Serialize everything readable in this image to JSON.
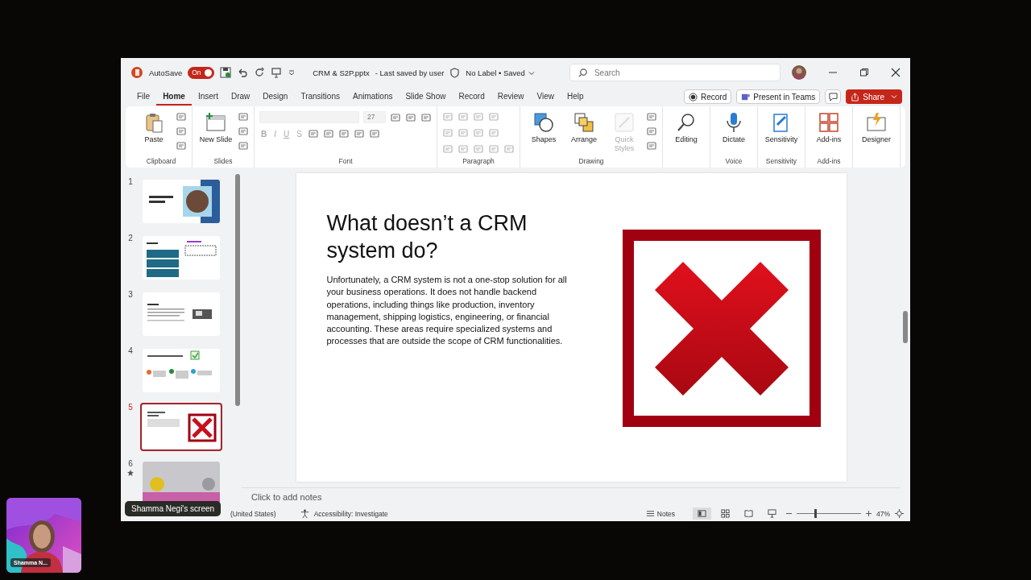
{
  "meeting": {
    "screen_label": "Shamma Negi's screen",
    "participant_name": "Shamma N..."
  },
  "window": {
    "autosave_label": "AutoSave",
    "autosave_on": true,
    "autosave_state": "On",
    "file_name": "CRM & S2P.pptx",
    "save_status": "- Last saved by user",
    "sensitivity_label": "No Label • Saved",
    "search_placeholder": "Search"
  },
  "ribbon_tabs": [
    {
      "label": "File",
      "selected": false
    },
    {
      "label": "Home",
      "selected": true
    },
    {
      "label": "Insert",
      "selected": false
    },
    {
      "label": "Draw",
      "selected": false
    },
    {
      "label": "Design",
      "selected": false
    },
    {
      "label": "Transitions",
      "selected": false
    },
    {
      "label": "Animations",
      "selected": false
    },
    {
      "label": "Slide Show",
      "selected": false
    },
    {
      "label": "Record",
      "selected": false
    },
    {
      "label": "Review",
      "selected": false
    },
    {
      "label": "View",
      "selected": false
    },
    {
      "label": "Help",
      "selected": false
    }
  ],
  "ribbon_actions": {
    "record": "Record",
    "present": "Present in Teams",
    "share": "Share"
  },
  "ribbon_groups": [
    {
      "kind": "clipboard",
      "name": "Clipboard",
      "commands": [
        {
          "label": "Paste",
          "kind": "paste",
          "disabled": false
        }
      ]
    },
    {
      "kind": "slides",
      "name": "Slides",
      "commands": [
        {
          "label": "New Slide",
          "kind": "new-slide",
          "disabled": false
        }
      ]
    },
    {
      "kind": "font",
      "name": "Font",
      "font_size": "27",
      "format_buttons": [
        "B",
        "I",
        "U",
        "S"
      ],
      "disabled": true
    },
    {
      "kind": "paragraph",
      "name": "Paragraph",
      "disabled": true
    },
    {
      "kind": "drawing",
      "name": "Drawing",
      "commands": [
        {
          "label": "Shapes",
          "kind": "shapes",
          "disabled": false
        },
        {
          "label": "Arrange",
          "kind": "arrange",
          "disabled": false
        },
        {
          "label": "Quick Styles",
          "kind": "quick-styles",
          "disabled": true
        }
      ]
    },
    {
      "kind": "commands",
      "commands": [
        {
          "label": "Editing",
          "kind": "editing",
          "disabled": false
        }
      ]
    },
    {
      "kind": "commands",
      "name": "Voice",
      "commands": [
        {
          "label": "Dictate",
          "kind": "dictate",
          "disabled": false
        }
      ]
    },
    {
      "kind": "commands",
      "name": "Sensitivity",
      "commands": [
        {
          "label": "Sensitivity",
          "kind": "sensitivity",
          "disabled": false
        }
      ]
    },
    {
      "kind": "commands",
      "name": "Add-ins",
      "commands": [
        {
          "label": "Add-ins",
          "kind": "add-ins",
          "disabled": false
        }
      ]
    },
    {
      "kind": "commands",
      "commands": [
        {
          "label": "Designer",
          "kind": "designer",
          "disabled": false
        }
      ]
    }
  ],
  "slides": [
    {
      "number": "1",
      "selected": false,
      "starred": false
    },
    {
      "number": "2",
      "selected": false,
      "starred": false
    },
    {
      "number": "3",
      "selected": false,
      "starred": false
    },
    {
      "number": "4",
      "selected": false,
      "starred": false
    },
    {
      "number": "5",
      "selected": true,
      "starred": false
    },
    {
      "number": "6",
      "selected": false,
      "starred": true
    }
  ],
  "slide": {
    "title": "What doesn’t a CRM system do?",
    "body": "Unfortunately, a CRM system is not a one-stop solution for all your business operations. It does not handle backend operations, including things like production, inventory management, shipping logistics, engineering, or financial accounting. These areas require specialized systems and processes that are outside the scope of CRM functionalities."
  },
  "notes_placeholder": "Click to add notes",
  "status_bar": {
    "language": "(United States)",
    "accessibility": "Accessibility: Investigate",
    "notes": "Notes",
    "views": [
      {
        "kind": "normal",
        "selected": true
      },
      {
        "kind": "sorter",
        "selected": false
      },
      {
        "kind": "reading",
        "selected": false
      },
      {
        "kind": "slideshow",
        "selected": false
      }
    ],
    "zoom": {
      "level": 0.28,
      "reading": "47%"
    }
  }
}
